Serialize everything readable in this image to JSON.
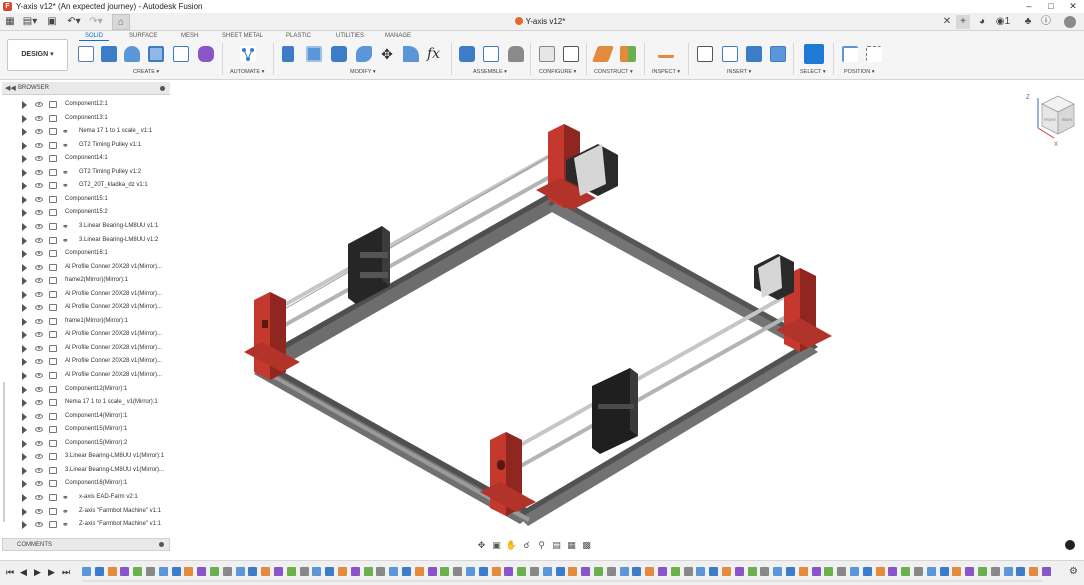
{
  "window": {
    "title": "Y-axis v12* (An expected journey) - Autodesk Fusion",
    "document_tab": "Y-axis v12*"
  },
  "ribbon": {
    "workspace": "DESIGN ▾",
    "tabs": [
      "SOLID",
      "SURFACE",
      "MESH",
      "SHEET METAL",
      "PLASTIC",
      "UTILITIES",
      "MANAGE"
    ],
    "active_tab": "SOLID",
    "groups": [
      "CREATE ▾",
      "AUTOMATE ▾",
      "MODIFY ▾",
      "ASSEMBLE ▾",
      "CONFIGURE ▾",
      "CONSTRUCT ▾",
      "INSPECT ▾",
      "INSERT ▾",
      "SELECT ▾",
      "POSITION ▾"
    ]
  },
  "browser": {
    "title": "BROWSER",
    "items": [
      {
        "label": "Component12:1",
        "linked": false
      },
      {
        "label": "Component13:1",
        "linked": false
      },
      {
        "label": "Nema 17 1 to 1 scale_ v1:1",
        "linked": true
      },
      {
        "label": "GT2 Timing Pulley v1:1",
        "linked": true
      },
      {
        "label": "Component14:1",
        "linked": false
      },
      {
        "label": "GT2 Timing Pulley v1:2",
        "linked": true
      },
      {
        "label": "GT2_20T_kladka_dz v1:1",
        "linked": true
      },
      {
        "label": "Component15:1",
        "linked": false
      },
      {
        "label": "Component15:2",
        "linked": false
      },
      {
        "label": "3.Linear Bearing-LM8UU v1:1",
        "linked": true
      },
      {
        "label": "3.Linear Bearing-LM8UU v1:2",
        "linked": true
      },
      {
        "label": "Component16:1",
        "linked": false
      },
      {
        "label": "Al Profile Conner 20X28 v1(Mirror)...",
        "linked": false
      },
      {
        "label": "frame2(Mirror)(Mirror):1",
        "linked": false
      },
      {
        "label": "Al Profile Conner 20X28 v1(Mirror)...",
        "linked": false
      },
      {
        "label": "Al Profile Conner 20X28 v1(Mirror)...",
        "linked": false
      },
      {
        "label": "frame1(Mirror)(Mirror):1",
        "linked": false
      },
      {
        "label": "Al Profile Conner 20X28 v1(Mirror)...",
        "linked": false
      },
      {
        "label": "Al Profile Conner 20X28 v1(Mirror)...",
        "linked": false
      },
      {
        "label": "Al Profile Conner 20X28 v1(Mirror)...",
        "linked": false
      },
      {
        "label": "Al Profile Conner 20X28 v1(Mirror)...",
        "linked": false
      },
      {
        "label": "Component12(Mirror):1",
        "linked": false
      },
      {
        "label": "Nema 17 1 to 1 scale_ v1(Mirror):1",
        "linked": false
      },
      {
        "label": "Component14(Mirror):1",
        "linked": false
      },
      {
        "label": "Component15(Mirror):1",
        "linked": false
      },
      {
        "label": "Component15(Mirror):2",
        "linked": false
      },
      {
        "label": "3.Linear Bearing-LM8UU v1(Mirror):1",
        "linked": false
      },
      {
        "label": "3.Linear Bearing-LM8UU v1(Mirror)...",
        "linked": false
      },
      {
        "label": "Component16(Mirror):1",
        "linked": false
      },
      {
        "label": "x-axis EAD-Farm v2:1",
        "linked": true
      },
      {
        "label": "Z-axis \"Farmbot Machine\" v1:1",
        "linked": true
      },
      {
        "label": "Z-axis \"Farmbot Machine\" v1:1",
        "linked": true
      }
    ]
  },
  "comments": {
    "title": "COMMENTS"
  },
  "viewcube": {
    "z": "Z",
    "x": "X",
    "front": "FRONT",
    "right": "RIGHT"
  },
  "colors": {
    "accent": "#0f6ecd",
    "part_red": "#c4382d",
    "profile_gray": "#5b5b5b",
    "rod_gray": "#b9b9b9",
    "motor_black": "#2a2a2a"
  },
  "icons": [
    "grid-icon",
    "file-icon",
    "save-icon",
    "undo-icon",
    "redo-icon",
    "home-icon",
    "close-icon",
    "add-tab-icon",
    "online-icon",
    "jobs-icon",
    "notification-icon",
    "help-icon",
    "profile-icon"
  ],
  "timeline": {
    "feature_count": 76
  }
}
